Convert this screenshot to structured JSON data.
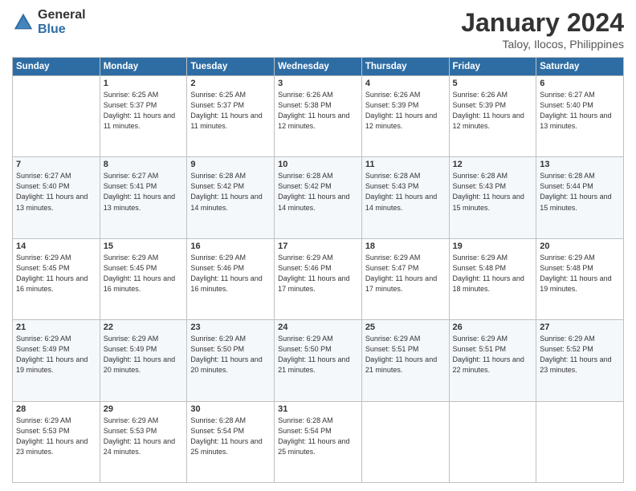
{
  "logo": {
    "general": "General",
    "blue": "Blue"
  },
  "header": {
    "month": "January 2024",
    "location": "Taloy, Ilocos, Philippines"
  },
  "weekdays": [
    "Sunday",
    "Monday",
    "Tuesday",
    "Wednesday",
    "Thursday",
    "Friday",
    "Saturday"
  ],
  "weeks": [
    [
      {
        "day": "",
        "info": ""
      },
      {
        "day": "1",
        "info": "Sunrise: 6:25 AM\nSunset: 5:37 PM\nDaylight: 11 hours and 11 minutes."
      },
      {
        "day": "2",
        "info": "Sunrise: 6:25 AM\nSunset: 5:37 PM\nDaylight: 11 hours and 11 minutes."
      },
      {
        "day": "3",
        "info": "Sunrise: 6:26 AM\nSunset: 5:38 PM\nDaylight: 11 hours and 12 minutes."
      },
      {
        "day": "4",
        "info": "Sunrise: 6:26 AM\nSunset: 5:39 PM\nDaylight: 11 hours and 12 minutes."
      },
      {
        "day": "5",
        "info": "Sunrise: 6:26 AM\nSunset: 5:39 PM\nDaylight: 11 hours and 12 minutes."
      },
      {
        "day": "6",
        "info": "Sunrise: 6:27 AM\nSunset: 5:40 PM\nDaylight: 11 hours and 13 minutes."
      }
    ],
    [
      {
        "day": "7",
        "info": "Sunrise: 6:27 AM\nSunset: 5:40 PM\nDaylight: 11 hours and 13 minutes."
      },
      {
        "day": "8",
        "info": "Sunrise: 6:27 AM\nSunset: 5:41 PM\nDaylight: 11 hours and 13 minutes."
      },
      {
        "day": "9",
        "info": "Sunrise: 6:28 AM\nSunset: 5:42 PM\nDaylight: 11 hours and 14 minutes."
      },
      {
        "day": "10",
        "info": "Sunrise: 6:28 AM\nSunset: 5:42 PM\nDaylight: 11 hours and 14 minutes."
      },
      {
        "day": "11",
        "info": "Sunrise: 6:28 AM\nSunset: 5:43 PM\nDaylight: 11 hours and 14 minutes."
      },
      {
        "day": "12",
        "info": "Sunrise: 6:28 AM\nSunset: 5:43 PM\nDaylight: 11 hours and 15 minutes."
      },
      {
        "day": "13",
        "info": "Sunrise: 6:28 AM\nSunset: 5:44 PM\nDaylight: 11 hours and 15 minutes."
      }
    ],
    [
      {
        "day": "14",
        "info": "Sunrise: 6:29 AM\nSunset: 5:45 PM\nDaylight: 11 hours and 16 minutes."
      },
      {
        "day": "15",
        "info": "Sunrise: 6:29 AM\nSunset: 5:45 PM\nDaylight: 11 hours and 16 minutes."
      },
      {
        "day": "16",
        "info": "Sunrise: 6:29 AM\nSunset: 5:46 PM\nDaylight: 11 hours and 16 minutes."
      },
      {
        "day": "17",
        "info": "Sunrise: 6:29 AM\nSunset: 5:46 PM\nDaylight: 11 hours and 17 minutes."
      },
      {
        "day": "18",
        "info": "Sunrise: 6:29 AM\nSunset: 5:47 PM\nDaylight: 11 hours and 17 minutes."
      },
      {
        "day": "19",
        "info": "Sunrise: 6:29 AM\nSunset: 5:48 PM\nDaylight: 11 hours and 18 minutes."
      },
      {
        "day": "20",
        "info": "Sunrise: 6:29 AM\nSunset: 5:48 PM\nDaylight: 11 hours and 19 minutes."
      }
    ],
    [
      {
        "day": "21",
        "info": "Sunrise: 6:29 AM\nSunset: 5:49 PM\nDaylight: 11 hours and 19 minutes."
      },
      {
        "day": "22",
        "info": "Sunrise: 6:29 AM\nSunset: 5:49 PM\nDaylight: 11 hours and 20 minutes."
      },
      {
        "day": "23",
        "info": "Sunrise: 6:29 AM\nSunset: 5:50 PM\nDaylight: 11 hours and 20 minutes."
      },
      {
        "day": "24",
        "info": "Sunrise: 6:29 AM\nSunset: 5:50 PM\nDaylight: 11 hours and 21 minutes."
      },
      {
        "day": "25",
        "info": "Sunrise: 6:29 AM\nSunset: 5:51 PM\nDaylight: 11 hours and 21 minutes."
      },
      {
        "day": "26",
        "info": "Sunrise: 6:29 AM\nSunset: 5:51 PM\nDaylight: 11 hours and 22 minutes."
      },
      {
        "day": "27",
        "info": "Sunrise: 6:29 AM\nSunset: 5:52 PM\nDaylight: 11 hours and 23 minutes."
      }
    ],
    [
      {
        "day": "28",
        "info": "Sunrise: 6:29 AM\nSunset: 5:53 PM\nDaylight: 11 hours and 23 minutes."
      },
      {
        "day": "29",
        "info": "Sunrise: 6:29 AM\nSunset: 5:53 PM\nDaylight: 11 hours and 24 minutes."
      },
      {
        "day": "30",
        "info": "Sunrise: 6:28 AM\nSunset: 5:54 PM\nDaylight: 11 hours and 25 minutes."
      },
      {
        "day": "31",
        "info": "Sunrise: 6:28 AM\nSunset: 5:54 PM\nDaylight: 11 hours and 25 minutes."
      },
      {
        "day": "",
        "info": ""
      },
      {
        "day": "",
        "info": ""
      },
      {
        "day": "",
        "info": ""
      }
    ]
  ]
}
